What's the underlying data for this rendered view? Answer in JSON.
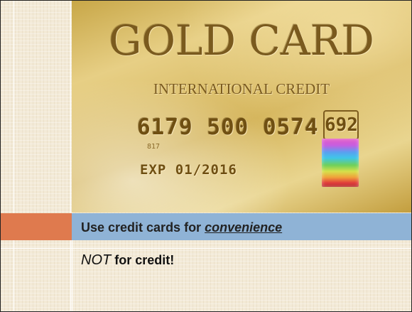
{
  "card": {
    "title": "GOLD CARD",
    "subtitle": "INTERNATIONAL CREDIT",
    "number": "6179 500 0574",
    "security_code": "692",
    "small_code": "817",
    "expiry": "EXP 01/2016"
  },
  "bullets": {
    "line1_prefix": "Use credit cards for ",
    "line1_emphasis": "convenience",
    "line2_emphasis": "NOT",
    "line2_rest": " for credit!"
  },
  "colors": {
    "accent_orange": "#df7a4e",
    "accent_blue": "#8fb3d6",
    "background": "#f3ead7"
  }
}
